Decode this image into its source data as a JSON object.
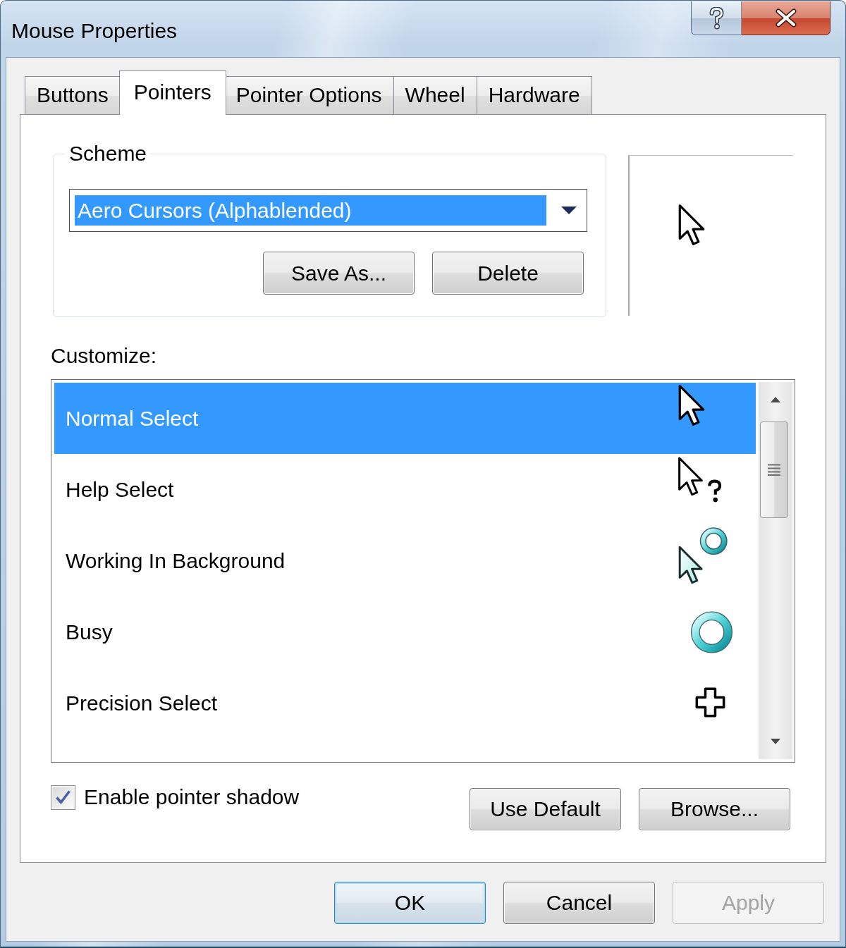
{
  "window": {
    "title": "Mouse Properties"
  },
  "tabs": [
    {
      "label": "Buttons",
      "selected": false
    },
    {
      "label": "Pointers",
      "selected": true
    },
    {
      "label": "Pointer Options",
      "selected": false
    },
    {
      "label": "Wheel",
      "selected": false
    },
    {
      "label": "Hardware",
      "selected": false
    }
  ],
  "scheme": {
    "label": "Scheme",
    "value": "Aero Cursors (Alphablended)",
    "highlighted": true,
    "buttons": [
      "Save As...",
      "Delete"
    ]
  },
  "customize": {
    "label": "Customize:",
    "items": [
      {
        "label": "Normal Select",
        "kind": "arrow",
        "selected": true
      },
      {
        "label": "Help Select",
        "kind": "help",
        "selected": false
      },
      {
        "label": "Working In Background",
        "kind": "working",
        "selected": false
      },
      {
        "label": "Busy",
        "kind": "busy",
        "selected": false
      },
      {
        "label": "Precision Select",
        "kind": "precision",
        "selected": false
      }
    ]
  },
  "shadow_checkbox": {
    "label": "Enable pointer shadow",
    "checked": true
  },
  "list_buttons": [
    "Use Default",
    "Browse..."
  ],
  "dialog_buttons": [
    {
      "label": "OK",
      "is_default": true,
      "disabled": false
    },
    {
      "label": "Cancel",
      "is_default": false,
      "disabled": false
    },
    {
      "label": "Apply",
      "is_default": false,
      "disabled": true
    }
  ]
}
